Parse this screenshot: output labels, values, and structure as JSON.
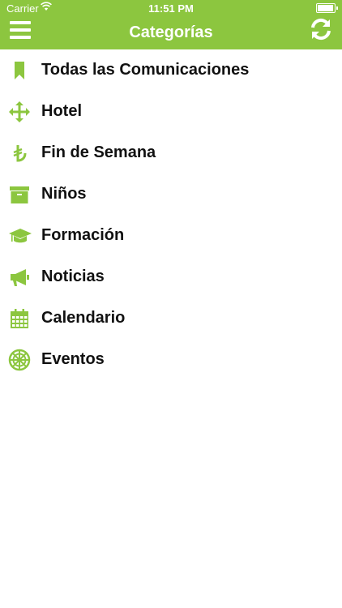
{
  "status_bar": {
    "carrier": "Carrier",
    "time": "11:51 PM",
    "battery_level": 1.0
  },
  "header": {
    "title": "Categorías"
  },
  "colors": {
    "accent": "#8cc63f",
    "text": "#111111"
  },
  "categories": [
    {
      "label": "Todas las Comunicaciones",
      "icon": "bookmark-icon"
    },
    {
      "label": "Hotel",
      "icon": "move-arrows-icon"
    },
    {
      "label": "Fin de Semana",
      "icon": "lira-icon"
    },
    {
      "label": "Niños",
      "icon": "archive-box-icon"
    },
    {
      "label": "Formación",
      "icon": "graduation-cap-icon"
    },
    {
      "label": "Noticias",
      "icon": "megaphone-icon"
    },
    {
      "label": "Calendario",
      "icon": "calendar-icon"
    },
    {
      "label": "Eventos",
      "icon": "empire-icon"
    }
  ]
}
